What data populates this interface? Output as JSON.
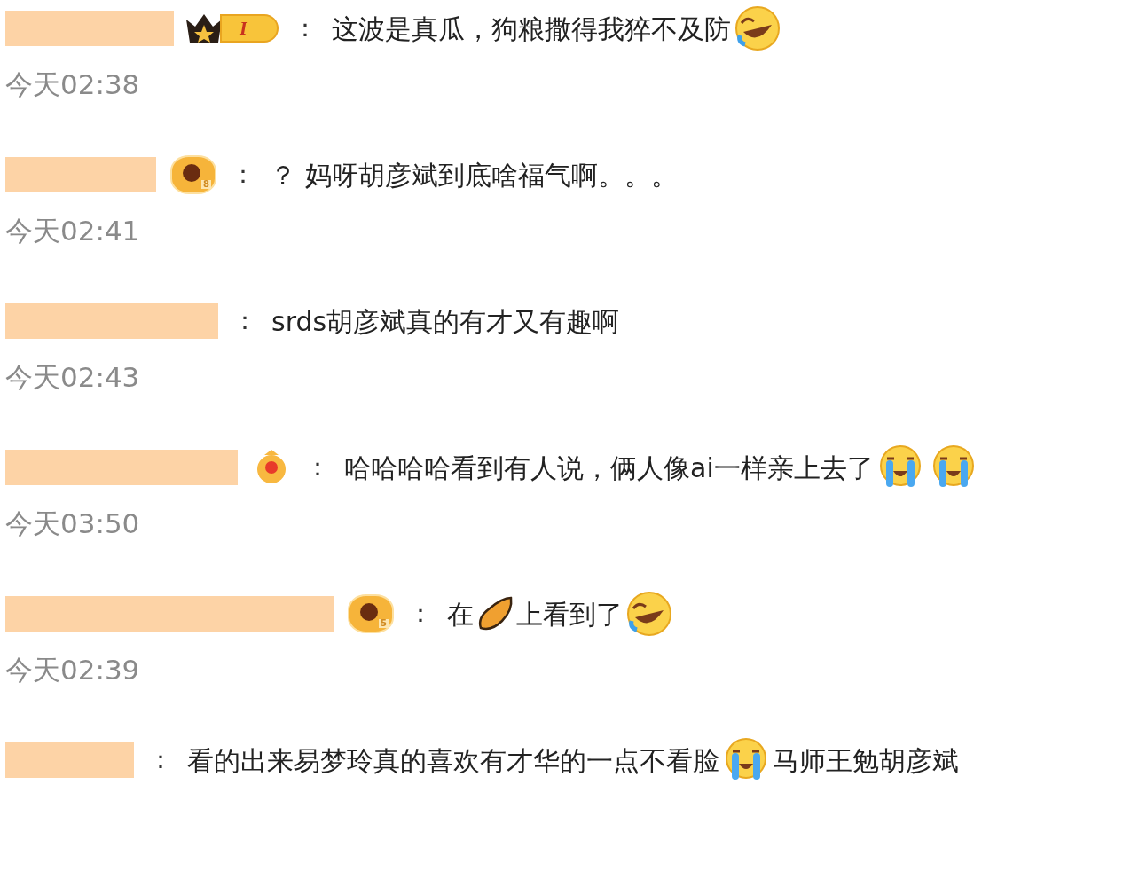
{
  "comments": [
    {
      "badge": {
        "kind": "crown",
        "label": "I"
      },
      "separator": "：",
      "parts": [
        {
          "kind": "text",
          "text": "这波是真瓜，狗粮撒得我猝不及防"
        },
        {
          "kind": "laughing"
        }
      ],
      "time": "今天02:38"
    },
    {
      "badge": {
        "kind": "medal",
        "label": "8"
      },
      "separator": "：",
      "parts": [
        {
          "kind": "text",
          "text": "？ 妈呀胡彦斌到底啥福气啊。。。"
        }
      ],
      "time": "今天02:41"
    },
    {
      "separator": "：",
      "parts": [
        {
          "kind": "text",
          "text": "srds胡彦斌真的有才又有趣啊"
        }
      ],
      "time": "今天02:43"
    },
    {
      "badge": {
        "kind": "flower"
      },
      "separator": "：",
      "parts": [
        {
          "kind": "text",
          "text": "哈哈哈哈看到有人说，俩人像ai一样亲上去了"
        },
        {
          "kind": "crying"
        },
        {
          "kind": "crying"
        }
      ],
      "time": "今天03:50"
    },
    {
      "badge": {
        "kind": "medal",
        "label": "5"
      },
      "separator": "：",
      "parts": [
        {
          "kind": "text",
          "text": "在"
        },
        {
          "kind": "potato"
        },
        {
          "kind": "text",
          "text": "上看到了"
        },
        {
          "kind": "laughing"
        }
      ],
      "time": "今天02:39"
    },
    {
      "separator": "：",
      "parts": [
        {
          "kind": "text",
          "text": "看的出来易梦玲真的喜欢有才华的一点不看脸"
        },
        {
          "kind": "crying"
        },
        {
          "kind": "text",
          "text": "马师王勉胡彦斌"
        }
      ]
    }
  ]
}
